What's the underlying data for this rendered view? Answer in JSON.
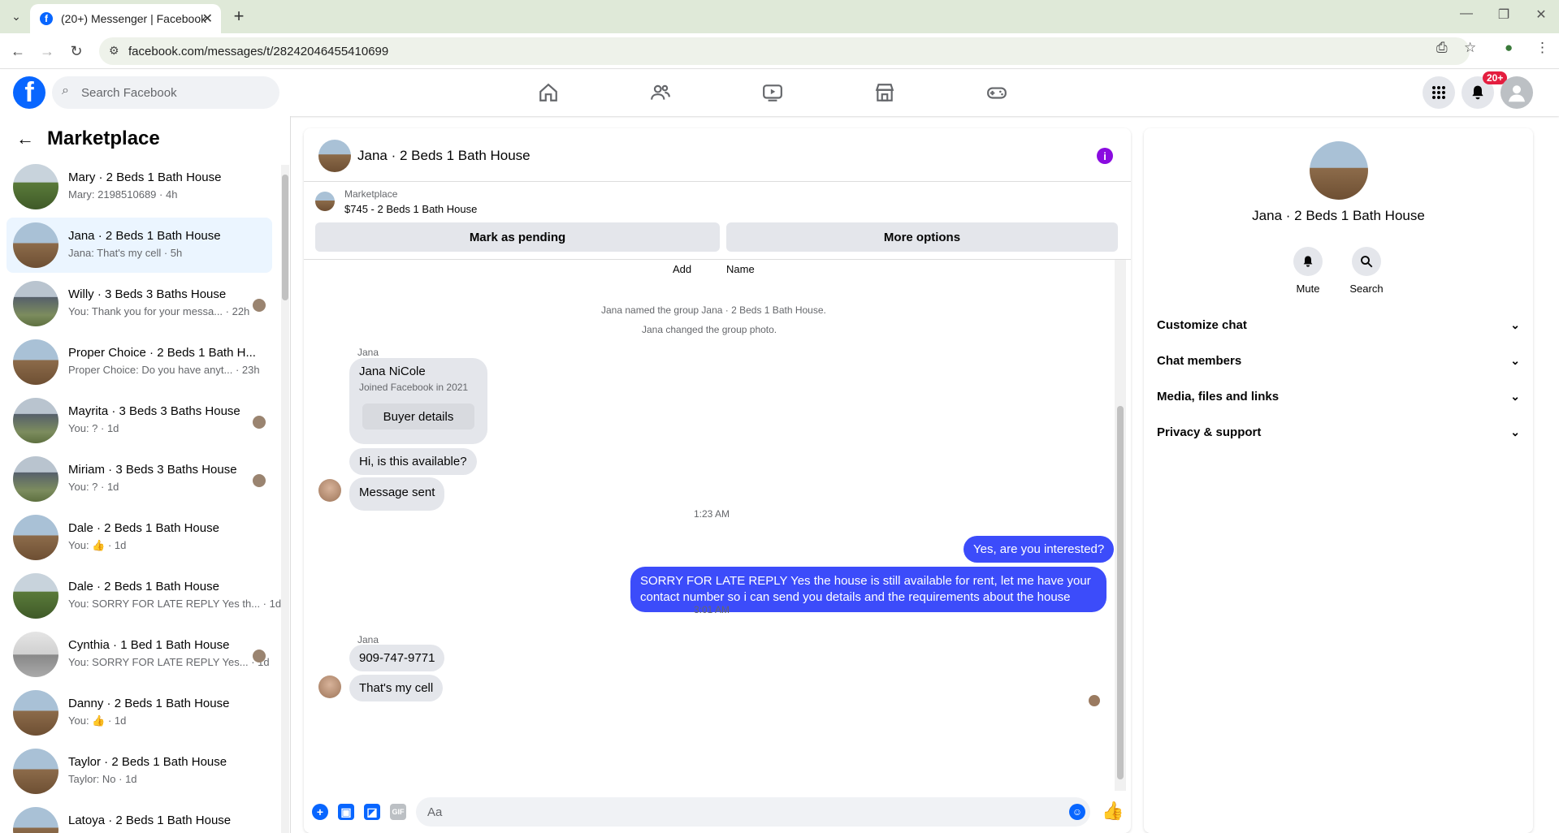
{
  "browser": {
    "tab_title": "(20+) Messenger | Facebook",
    "url": "facebook.com/messages/t/28242046455410699"
  },
  "fb": {
    "search_placeholder": "Search Facebook",
    "notif_badge": "20+"
  },
  "left": {
    "title": "Marketplace",
    "conversations": [
      {
        "name": "Mary · 2 Beds 1 Bath House",
        "snippet": "Mary: 2198510689 · 4h",
        "avatar": "g"
      },
      {
        "name": "Jana · 2 Beds 1 Bath House",
        "snippet": "Jana: That's my cell · 5h",
        "avatar": "",
        "active": true
      },
      {
        "name": "Willy · 3 Beds 3 Baths House",
        "snippet": "You: Thank you for your messa... · 22h",
        "avatar": "h"
      },
      {
        "name": "Proper Choice · 2 Beds 1 Bath H...",
        "snippet": "Proper Choice: Do you have anyt... · 23h",
        "avatar": ""
      },
      {
        "name": "Mayrita · 3 Beds 3 Baths House",
        "snippet": "You: ? · 1d",
        "avatar": "h"
      },
      {
        "name": "Miriam · 3 Beds 3 Baths House",
        "snippet": "You: ? · 1d",
        "avatar": "h"
      },
      {
        "name": "Dale · 2 Beds 1 Bath House",
        "snippet": "You: 👍 · 1d",
        "avatar": ""
      },
      {
        "name": "Dale · 2 Beds 1 Bath House",
        "snippet": "You: SORRY FOR LATE REPLY Yes th... · 1d",
        "avatar": "g"
      },
      {
        "name": "Cynthia · 1 Bed 1 Bath House",
        "snippet": "You: SORRY FOR LATE REPLY Yes... · 1d",
        "avatar": "i"
      },
      {
        "name": "Danny · 2 Beds 1 Bath House",
        "snippet": "You: 👍 · 1d",
        "avatar": ""
      },
      {
        "name": "Taylor · 2 Beds 1 Bath House",
        "snippet": "Taylor: No · 1d",
        "avatar": ""
      },
      {
        "name": "Latoya · 2 Beds 1 Bath House",
        "snippet": "",
        "avatar": ""
      }
    ]
  },
  "chat": {
    "title": "Jana · 2 Beds 1 Bath House",
    "listing_label": "Marketplace",
    "listing_price": "$745 - 2 Beds 1 Bath House",
    "mark_pending": "Mark as pending",
    "more_options": "More options",
    "add_label": "Add",
    "name_label": "Name",
    "sys1": "Jana named the group Jana · 2 Beds 1 Bath House.",
    "sys2": "Jana changed the group photo.",
    "sender": "Jana",
    "card_name": "Jana NiCole",
    "card_joined": "Joined Facebook in 2021",
    "card_button": "Buyer details",
    "msg1": "Hi, is this available?",
    "msg2": "Message sent",
    "time1": "1:23 AM",
    "out1": "Yes, are you interested?",
    "out2_line1": "SORRY FOR LATE REPLY Yes the house is still available for rent, let me have your",
    "out2_line2": "contact number so i can send you details and the requirements about the house",
    "time2": "3:01 AM",
    "sender2": "Jana",
    "msg3": "909-747-9771",
    "msg4": "That's my cell",
    "composer_placeholder": "Aa"
  },
  "info": {
    "title": "Jana · 2 Beds 1 Bath House",
    "mute": "Mute",
    "search": "Search",
    "rows": [
      "Customize chat",
      "Chat members",
      "Media, files and links",
      "Privacy & support"
    ]
  }
}
